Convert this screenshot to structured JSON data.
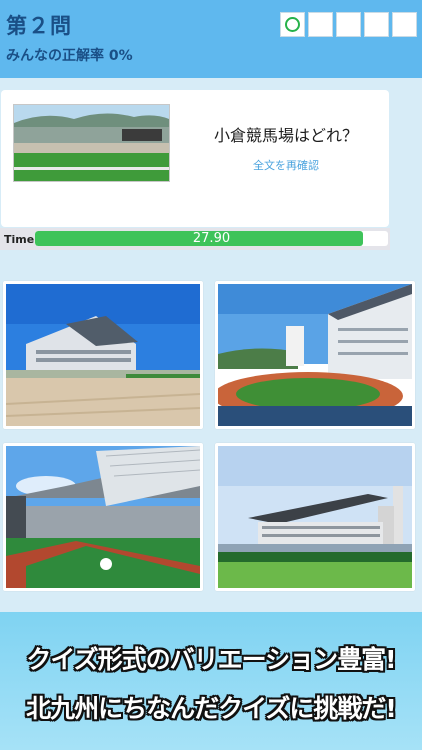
{
  "header": {
    "question_number": "第２問",
    "accuracy_text": "みんなの正解率 0%",
    "progress": [
      {
        "state": "correct",
        "icon": "circle-icon"
      },
      {
        "state": "empty"
      },
      {
        "state": "empty"
      },
      {
        "state": "empty"
      },
      {
        "state": "empty"
      }
    ]
  },
  "question": {
    "text": "小倉競馬場はどれ？",
    "link": "全文を再確認"
  },
  "timer": {
    "label": "Time",
    "value": "27.90",
    "fraction": 0.93
  },
  "answers": [
    {
      "image": "racecourse-stand-photo"
    },
    {
      "image": "racecourse-stadium-photo"
    },
    {
      "image": "racecourse-covered-stand-photo"
    },
    {
      "image": "racecourse-grandstand-photo"
    }
  ],
  "promo": {
    "line1": "クイズ形式のバリエーション豊富!",
    "line2": "北九州にちなんだクイズに挑戦だ!"
  },
  "colors": {
    "header_bg": "#5fb8ee",
    "timer_fill": "#3ec35a",
    "link": "#4aa3de",
    "correct": "#27b24a"
  }
}
